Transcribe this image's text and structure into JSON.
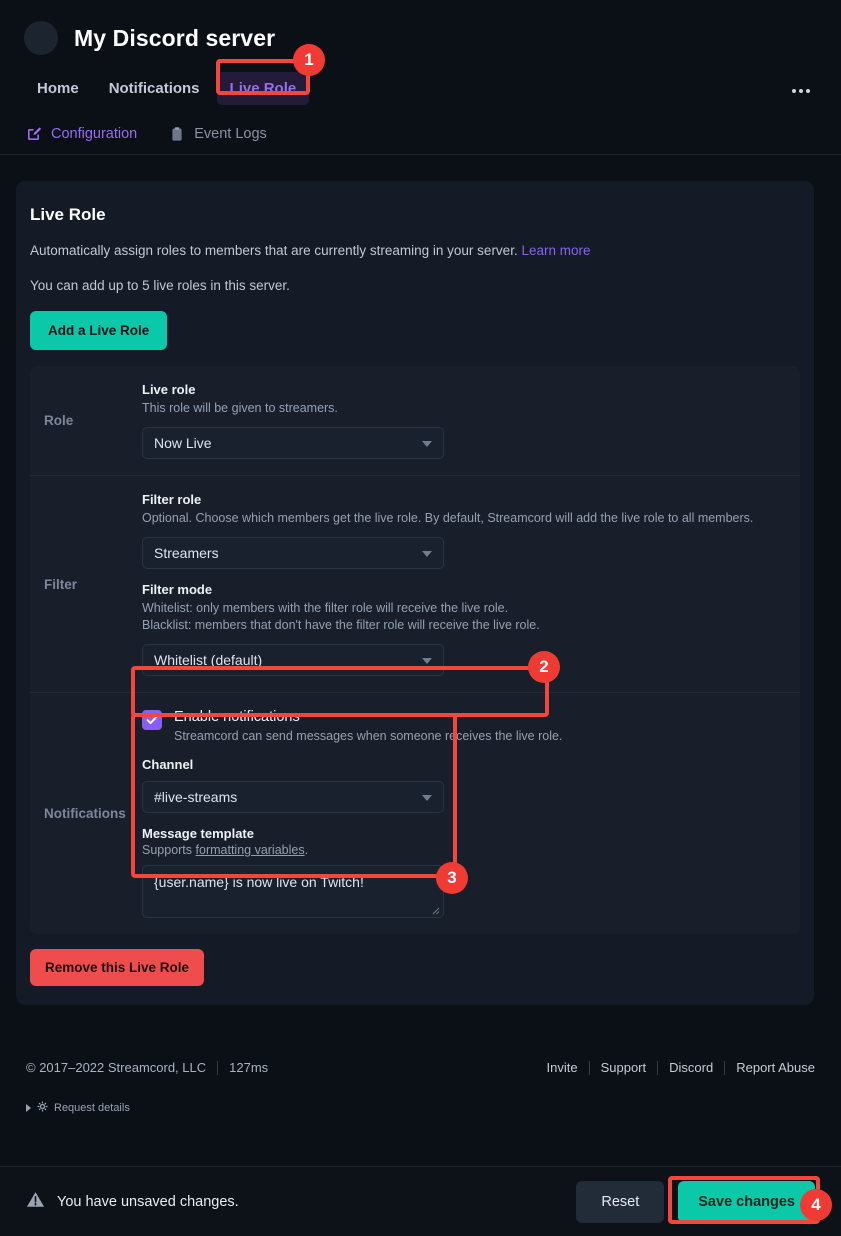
{
  "header": {
    "server_name": "My Discord server",
    "avatar": "server-avatar",
    "tabs": [
      {
        "label": "Home",
        "active": false
      },
      {
        "label": "Notifications",
        "active": false
      },
      {
        "label": "Live Role",
        "active": true
      }
    ],
    "overflow_menu": "more-options"
  },
  "subnav": [
    {
      "label": "Configuration",
      "icon": "edit-square-icon",
      "active": true
    },
    {
      "label": "Event Logs",
      "icon": "clipboard-icon",
      "active": false
    }
  ],
  "card": {
    "title": "Live Role",
    "description": "Automatically assign roles to members that are currently streaming in your server.",
    "learn_more": "Learn more",
    "limit_note": "You can add up to 5 live roles in this server.",
    "add_button": "Add a Live Role",
    "remove_button": "Remove this Live Role"
  },
  "sections": {
    "role": {
      "label": "Role",
      "field_title": "Live role",
      "field_help": "This role will be given to streamers.",
      "select_value": "Now Live"
    },
    "filter": {
      "label": "Filter",
      "role_title": "Filter role",
      "role_help": "Optional. Choose which members get the live role. By default, Streamcord will add the live role to all members.",
      "role_value": "Streamers",
      "mode_title": "Filter mode",
      "mode_help_line1": "Whitelist: only members with the filter role will receive the live role.",
      "mode_help_line2": "Blacklist: members that don't have the filter role will receive the live role.",
      "mode_value": "Whitelist (default)"
    },
    "notifications": {
      "label": "Notifications",
      "enable_label": "Enable notifications",
      "enable_help": "Streamcord can send messages when someone receives the live role.",
      "enabled": true,
      "channel_title": "Channel",
      "channel_value": "#live-streams",
      "template_title": "Message template",
      "template_help_prefix": "Supports ",
      "template_help_link": "formatting variables",
      "template_help_suffix": ".",
      "template_value": "{user.name} is now live on Twitch!"
    }
  },
  "footer": {
    "copyright": "© 2017–2022 Streamcord, LLC",
    "latency": "127ms",
    "links": [
      "Invite",
      "Support",
      "Discord",
      "Report Abuse"
    ],
    "request_details": "Request details"
  },
  "bottombar": {
    "warning_icon": "warning-triangle-icon",
    "message": "You have unsaved changes.",
    "reset_label": "Reset",
    "save_label": "Save changes"
  },
  "annotations": [
    {
      "number": "1"
    },
    {
      "number": "2"
    },
    {
      "number": "3"
    },
    {
      "number": "4"
    }
  ],
  "colors": {
    "accent_teal": "#0bc9a8",
    "accent_purple": "#8b5cf6",
    "danger_red": "#ef4d4d",
    "annotation_red": "#ef3b34",
    "page_bg": "#0b0f16",
    "card_bg": "#141b26",
    "panel_bg": "#181f2a"
  }
}
